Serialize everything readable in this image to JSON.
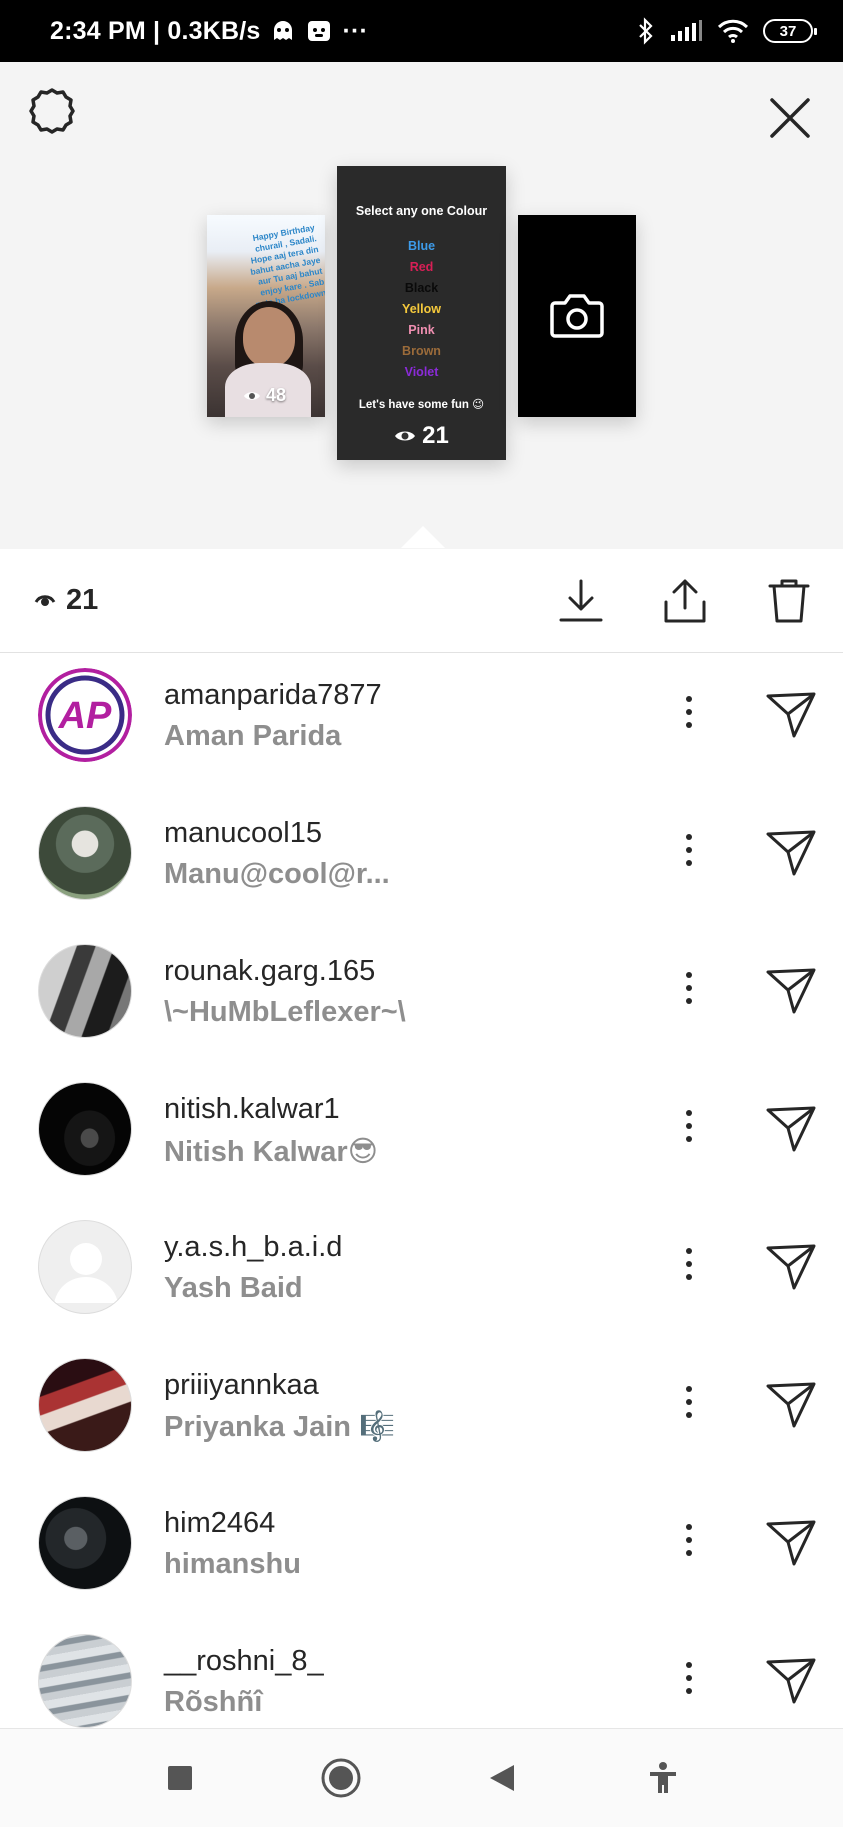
{
  "status_bar": {
    "time_speed": "2:34 PM | 0.3KB/s",
    "more": "···",
    "battery": "37"
  },
  "story_area": {
    "thumbnails": [
      {
        "caption": "Happy Birthday churail , Sadali. Hope aaj tera din bahut aacha Jaye aur Tu aaj bahut enjoy kare . Sab pata ha lockdown",
        "views": "48"
      },
      {
        "title": "Select any one Colour",
        "colours": [
          {
            "name": "Blue",
            "color": "#3d9be9"
          },
          {
            "name": "Red",
            "color": "#d81f56"
          },
          {
            "name": "Black",
            "color": "#0a0a0a"
          },
          {
            "name": "Yellow",
            "color": "#f5c93c"
          },
          {
            "name": "Pink",
            "color": "#f08fb1"
          },
          {
            "name": "Brown",
            "color": "#9b6b3a"
          },
          {
            "name": "Violet",
            "color": "#8b2bd9"
          }
        ],
        "footer": "Let's have some fun 😉",
        "views": "21"
      },
      {
        "icon": "camera-icon"
      }
    ]
  },
  "actions": {
    "view_count": "21",
    "buttons": [
      "download-icon",
      "share-icon",
      "trash-icon"
    ]
  },
  "viewers": [
    {
      "username": "amanparida7877",
      "full_name": "Aman Parida"
    },
    {
      "username": "manucool15",
      "full_name": "Manu@cool@r..."
    },
    {
      "username": "rounak.garg.165",
      "full_name": "\\~HuMbLeflexer~\\"
    },
    {
      "username": "nitish.kalwar1",
      "full_name": "Nitish Kalwar😎"
    },
    {
      "username": "y.a.s.h_b.a.i.d",
      "full_name": "Yash Baid"
    },
    {
      "username": "priiiyannkaa",
      "full_name": "Priyanka Jain 🎼"
    },
    {
      "username": "him2464",
      "full_name": "himanshu"
    },
    {
      "username": "__roshni_8_",
      "full_name": "Rõshñî"
    }
  ]
}
